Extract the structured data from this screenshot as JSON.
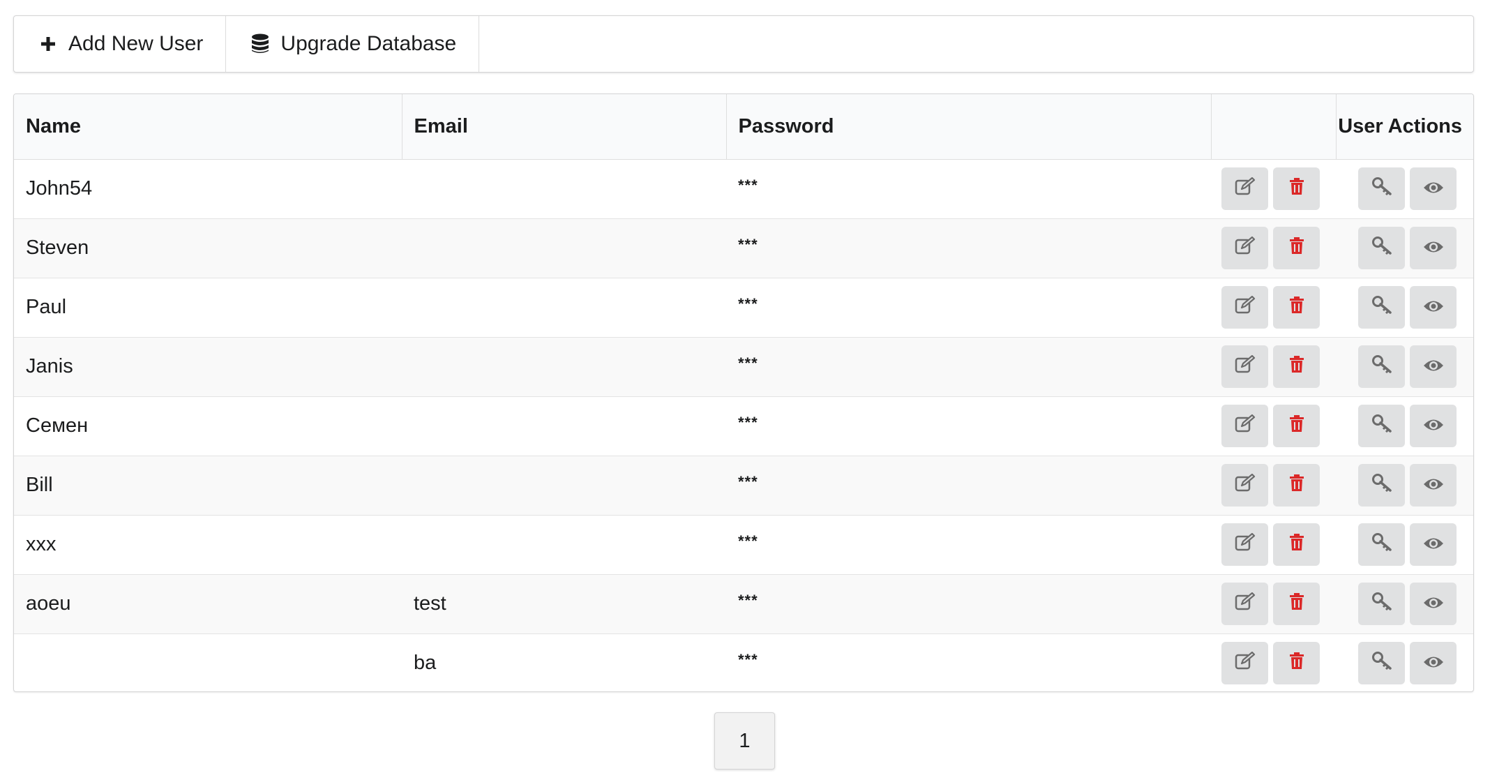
{
  "toolbar": {
    "add_user_label": "Add New User",
    "upgrade_db_label": "Upgrade Database"
  },
  "table": {
    "headers": {
      "name": "Name",
      "email": "Email",
      "password": "Password",
      "edit": "",
      "user_actions": "User Actions"
    },
    "rows": [
      {
        "name": "John54",
        "email": "",
        "password": "***"
      },
      {
        "name": "Steven",
        "email": "",
        "password": "***"
      },
      {
        "name": "Paul",
        "email": "",
        "password": "***"
      },
      {
        "name": "Janis",
        "email": "",
        "password": "***"
      },
      {
        "name": "Семен",
        "email": "",
        "password": "***"
      },
      {
        "name": "Bill",
        "email": "",
        "password": "***"
      },
      {
        "name": "xxx",
        "email": "",
        "password": "***"
      },
      {
        "name": "aoeu",
        "email": "test",
        "password": "***"
      },
      {
        "name": "",
        "email": "ba",
        "password": "***"
      }
    ],
    "row_icons": {
      "edit": "edit-icon",
      "delete": "trash-icon",
      "key": "key-icon",
      "view": "eye-icon"
    }
  },
  "pagination": {
    "current_page": "1"
  },
  "colors": {
    "delete_icon": "#db2828",
    "icon_gray": "#6b6b6b",
    "button_bg": "#e0e1e2"
  }
}
